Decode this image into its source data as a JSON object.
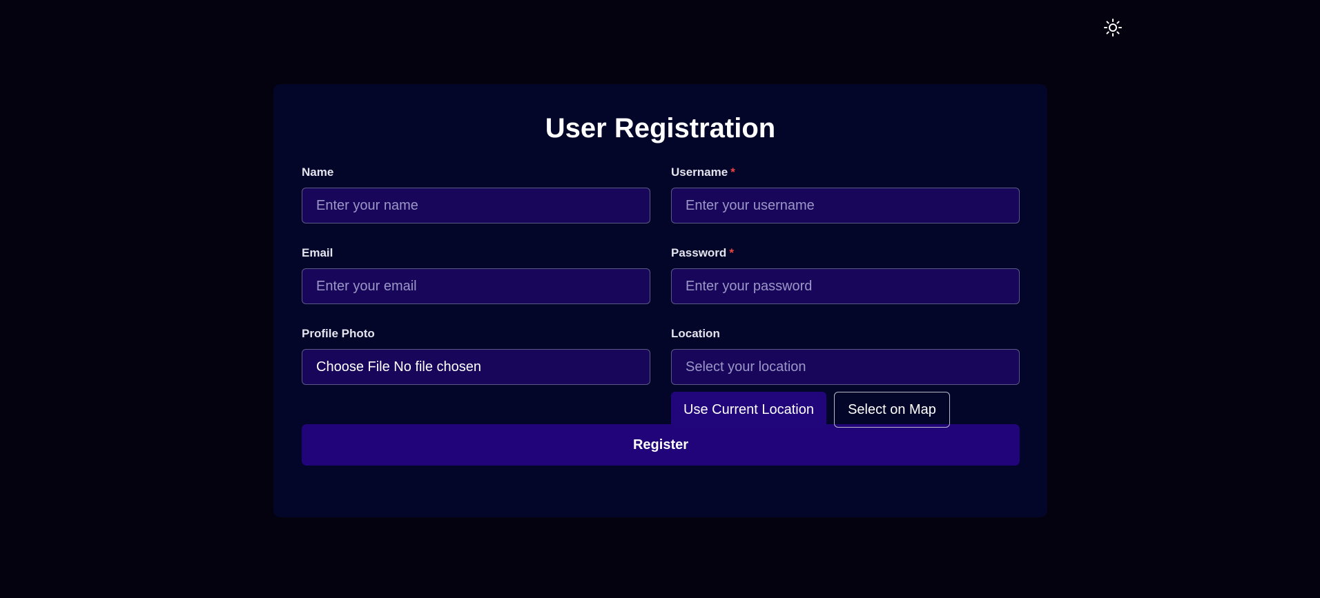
{
  "theme_toggle": {
    "icon": "sun-icon"
  },
  "form": {
    "title": "User Registration",
    "required_mark": "*",
    "name": {
      "label": "Name",
      "placeholder": "Enter your name"
    },
    "username": {
      "label": "Username",
      "placeholder": "Enter your username"
    },
    "email": {
      "label": "Email",
      "placeholder": "Enter your email"
    },
    "password": {
      "label": "Password",
      "placeholder": "Enter your password"
    },
    "profile_photo": {
      "label": "Profile Photo",
      "button_text": "Choose File",
      "status_text": "No file chosen"
    },
    "location": {
      "label": "Location",
      "placeholder": "Select your location",
      "use_current_label": "Use Current Location",
      "select_on_map_label": "Select on Map"
    },
    "register_label": "Register"
  },
  "colors": {
    "background": "#04020f",
    "card": "#030629",
    "input": "#18065a",
    "primary": "#20067a",
    "required": "#ef4444"
  }
}
